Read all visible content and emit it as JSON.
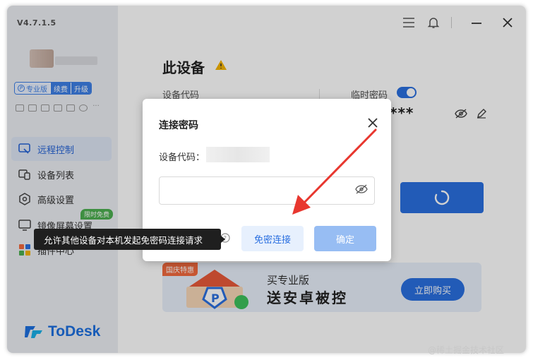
{
  "app": {
    "version": "V4.7.1.5",
    "brand": "ToDesk",
    "accent_color": "#2a6fe0"
  },
  "sidebar": {
    "vip": {
      "pro_label": "专业版",
      "renew_label": "续费",
      "upgrade_label": "升级"
    },
    "items": [
      {
        "label": "远程控制",
        "icon": "remote-control-icon",
        "active": true
      },
      {
        "label": "设备列表",
        "icon": "device-list-icon",
        "active": false
      },
      {
        "label": "高级设置",
        "icon": "settings-icon",
        "active": false
      },
      {
        "label": "镜像屏幕设置",
        "icon": "mirror-screen-icon",
        "active": false
      },
      {
        "label": "插件中心",
        "icon": "plugin-icon",
        "active": false
      }
    ],
    "badge": "限时免费"
  },
  "main": {
    "title": "此设备",
    "device_code_label": "设备代码",
    "temp_password_label": "临时密码",
    "temp_password_value": "***"
  },
  "banner": {
    "tag": "国庆特惠",
    "line1": "买专业版",
    "line2": "送安卓被控",
    "buy_label": "立即购买"
  },
  "modal": {
    "title": "连接密码",
    "device_code_label": "设备代码：",
    "password_placeholder": "",
    "free_connect_label": "免密连接",
    "ok_label": "确定"
  },
  "tooltip": "允许其他设备对本机发起免密码连接请求",
  "watermark": "@稀土掘金技术社区"
}
